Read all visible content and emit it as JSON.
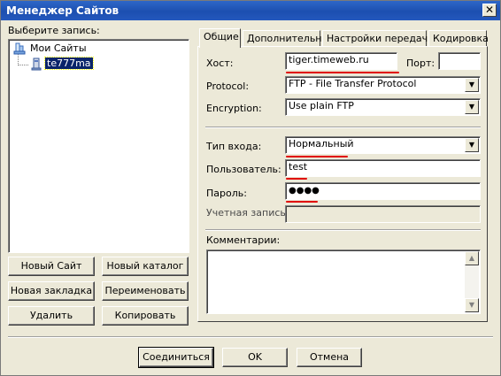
{
  "window": {
    "title": "Менеджер Сайтов",
    "close_glyph": "✕"
  },
  "left_panel": {
    "label": "Выберите запись:",
    "tree": {
      "root": "Мои Сайты",
      "items": [
        "te777ma"
      ],
      "selected": "te777ma"
    },
    "buttons": {
      "new_site": "Новый Сайт",
      "new_folder": "Новый каталог",
      "new_bookmark": "Новая закладка",
      "rename": "Переименовать",
      "delete": "Удалить",
      "copy": "Копировать"
    }
  },
  "tabs": [
    "Общие",
    "Дополнительно",
    "Настройки передачи",
    "Кодировка"
  ],
  "active_tab": "Общие",
  "general": {
    "host_label": "Хост:",
    "host_value": "tiger.timeweb.ru",
    "port_label": "Порт:",
    "port_value": "",
    "protocol_label": "Protocol:",
    "protocol_value": "FTP - File Transfer Protocol",
    "encryption_label": "Encryption:",
    "encryption_value": "Use plain FTP",
    "logon_type_label": "Тип входа:",
    "logon_type_value": "Нормальный",
    "user_label": "Пользователь:",
    "user_value": "test",
    "password_label": "Пароль:",
    "password_value": "●●●●",
    "account_label": "Учетная запись:",
    "account_value": "",
    "comments_label": "Комментарии:",
    "comments_value": ""
  },
  "footer": {
    "connect": "Соединиться",
    "ok": "OK",
    "cancel": "Отмена"
  },
  "colors": {
    "title_bar": "#1c4fb0",
    "selection": "#0a246a",
    "annotation_underline": "#e00000"
  },
  "icons": {
    "root": "folder-tree-icon",
    "site": "computer-site-icon",
    "dropdown": "down-arrow-icon",
    "scroll_up": "scroll-up-arrow-icon",
    "scroll_down": "scroll-down-arrow-icon"
  }
}
